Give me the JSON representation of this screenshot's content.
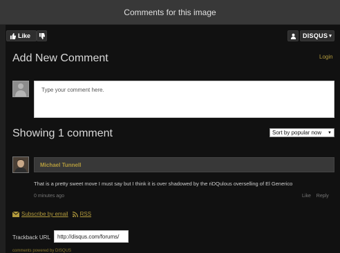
{
  "window": {
    "title": "Comments for this image"
  },
  "toolbar": {
    "like_label": "Like",
    "brand_label": "DISQUS",
    "brand_caret": "▾"
  },
  "add_comment": {
    "heading": "Add New Comment",
    "login_label": "Login",
    "placeholder": "Type your comment here."
  },
  "comments_section": {
    "heading": "Showing 1 comment",
    "sort_label": "Sort by popular now",
    "sort_caret": "▼"
  },
  "comments": [
    {
      "author": "Michael Tunnell",
      "text": "That is a pretty sweet move I must say but I think it is over shadowed by the riDQulous overselling of El Generico",
      "time": "0 minutes ago",
      "actions": [
        "Like",
        "Reply"
      ]
    }
  ],
  "footer": {
    "subscribe_label": "Subscribe by email",
    "rss_label": "RSS",
    "trackback_label": "Trackback URL",
    "trackback_value": "http://disqus.com/forums/",
    "powered_text": "comments powered by DISQUS"
  },
  "colors": {
    "accent": "#b39b3d",
    "background": "#111111"
  }
}
